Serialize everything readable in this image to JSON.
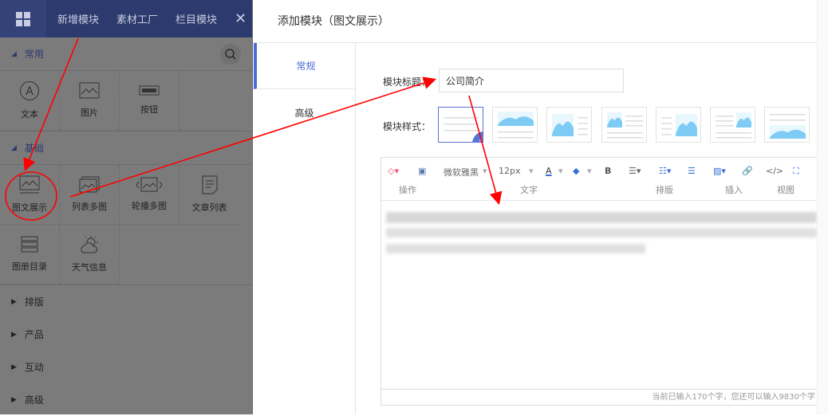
{
  "left_panel": {
    "tabs": [
      "新增模块",
      "素材工厂",
      "栏目模块"
    ],
    "sections": [
      {
        "label": "常用",
        "expanded": true,
        "items": [
          {
            "label": "文本",
            "icon": "text-icon"
          },
          {
            "label": "图片",
            "icon": "image-icon"
          },
          {
            "label": "按钮",
            "icon": "button-icon"
          }
        ]
      },
      {
        "label": "基础",
        "expanded": true,
        "items": [
          {
            "label": "图文展示",
            "icon": "image-text-icon"
          },
          {
            "label": "列表多图",
            "icon": "multi-image-icon"
          },
          {
            "label": "轮播多图",
            "icon": "carousel-icon"
          },
          {
            "label": "文章列表",
            "icon": "article-icon"
          },
          {
            "label": "图册目录",
            "icon": "album-icon"
          },
          {
            "label": "天气信息",
            "icon": "weather-icon"
          }
        ]
      },
      {
        "label": "排版",
        "expanded": false
      },
      {
        "label": "产品",
        "expanded": false
      },
      {
        "label": "互动",
        "expanded": false
      },
      {
        "label": "高级",
        "expanded": false
      }
    ]
  },
  "dialog": {
    "title": "添加模块（图文展示）",
    "tabs": [
      "常规",
      "高级"
    ],
    "active_tab": "常规",
    "title_label": "模块标题：",
    "title_value": "公司简介",
    "style_label": "模块样式：",
    "selected_style": 1,
    "editor": {
      "font": "微软雅黑",
      "size": "12px",
      "groups": [
        "操作",
        "文字",
        "排版",
        "插入",
        "视图"
      ],
      "footer": "当前已输入170个字，您还可以输入9830个字"
    }
  },
  "colors": {
    "header": "#2d3a6d",
    "accent": "#4a6cd4",
    "annotation": "#ff0000"
  }
}
